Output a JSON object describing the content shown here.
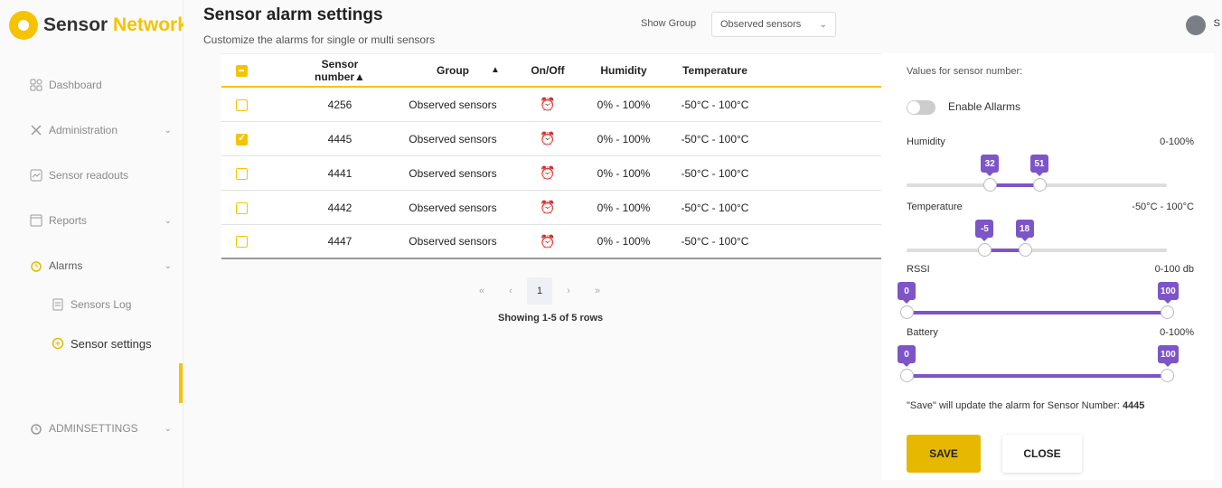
{
  "brand": {
    "name_part1": "Sensor",
    "name_part2": "Network"
  },
  "sidebar": {
    "items": [
      {
        "label": "Dashboard",
        "icon": "dashboard-icon"
      },
      {
        "label": "Administration",
        "icon": "tools-icon"
      },
      {
        "label": "Sensor readouts",
        "icon": "chart-icon"
      },
      {
        "label": "Reports",
        "icon": "report-icon"
      },
      {
        "label": "Alarms",
        "icon": "alarm-clock-icon"
      },
      {
        "label": "Sensors Log",
        "icon": "document-icon"
      },
      {
        "label": "Sensor settings",
        "icon": "alarm-add-icon"
      },
      {
        "label": "ADMINSETTINGS",
        "icon": "alarm-clock-icon"
      }
    ]
  },
  "header": {
    "title": "Sensor alarm settings",
    "subtitle": "Customize the alarms for single or multi sensors",
    "show_group_label": "Show Group",
    "group_select_value": "Observed sensors",
    "avatar_letter": "S"
  },
  "table": {
    "headers": {
      "sensor_number": "Sensor number▲",
      "group": "Group",
      "group_sort": "▲",
      "onoff": "On/Off",
      "humidity": "Humidity",
      "temperature": "Temperature"
    },
    "rows": [
      {
        "number": "4256",
        "group": "Observed sensors",
        "humidity": "0% - 100%",
        "temperature": "-50°C - 100°C",
        "checked": false
      },
      {
        "number": "4445",
        "group": "Observed sensors",
        "humidity": "0% - 100%",
        "temperature": "-50°C - 100°C",
        "checked": true
      },
      {
        "number": "4441",
        "group": "Observed sensors",
        "humidity": "0% - 100%",
        "temperature": "-50°C - 100°C",
        "checked": false
      },
      {
        "number": "4442",
        "group": "Observed sensors",
        "humidity": "0% - 100%",
        "temperature": "-50°C - 100°C",
        "checked": false
      },
      {
        "number": "4447",
        "group": "Observed sensors",
        "humidity": "0% - 100%",
        "temperature": "-50°C - 100°C",
        "checked": false
      }
    ]
  },
  "pager": {
    "first": "«",
    "prev": "‹",
    "page": "1",
    "next": "›",
    "last": "»",
    "showing": "Showing 1-5 of 5 rows"
  },
  "panel": {
    "title": "Values for sensor number:",
    "enable_label": "Enable Allarms",
    "enabled": false,
    "sliders": [
      {
        "label": "Humidity",
        "range": "0-100%",
        "min": 0,
        "max": 100,
        "low": 32,
        "high": 51,
        "low_label": "32",
        "high_label": "51"
      },
      {
        "label": "Temperature",
        "range": "-50°C - 100°C",
        "min": -50,
        "max": 100,
        "low": -5,
        "high": 18,
        "low_label": "-5",
        "high_label": "18"
      },
      {
        "label": "RSSI",
        "range": "0-100 db",
        "min": 0,
        "max": 100,
        "low": 0,
        "high": 100,
        "low_label": "0",
        "high_label": "100"
      },
      {
        "label": "Battery",
        "range": "0-100%",
        "min": 0,
        "max": 100,
        "low": 0,
        "high": 100,
        "low_label": "0",
        "high_label": "100"
      }
    ],
    "save_note": "\"Save\" will update the alarm for Sensor Number:",
    "save_note_number": "4445",
    "save_label": "SAVE",
    "close_label": "CLOSE"
  },
  "colors": {
    "accent": "#f5c300",
    "slider": "#7d55c7"
  }
}
